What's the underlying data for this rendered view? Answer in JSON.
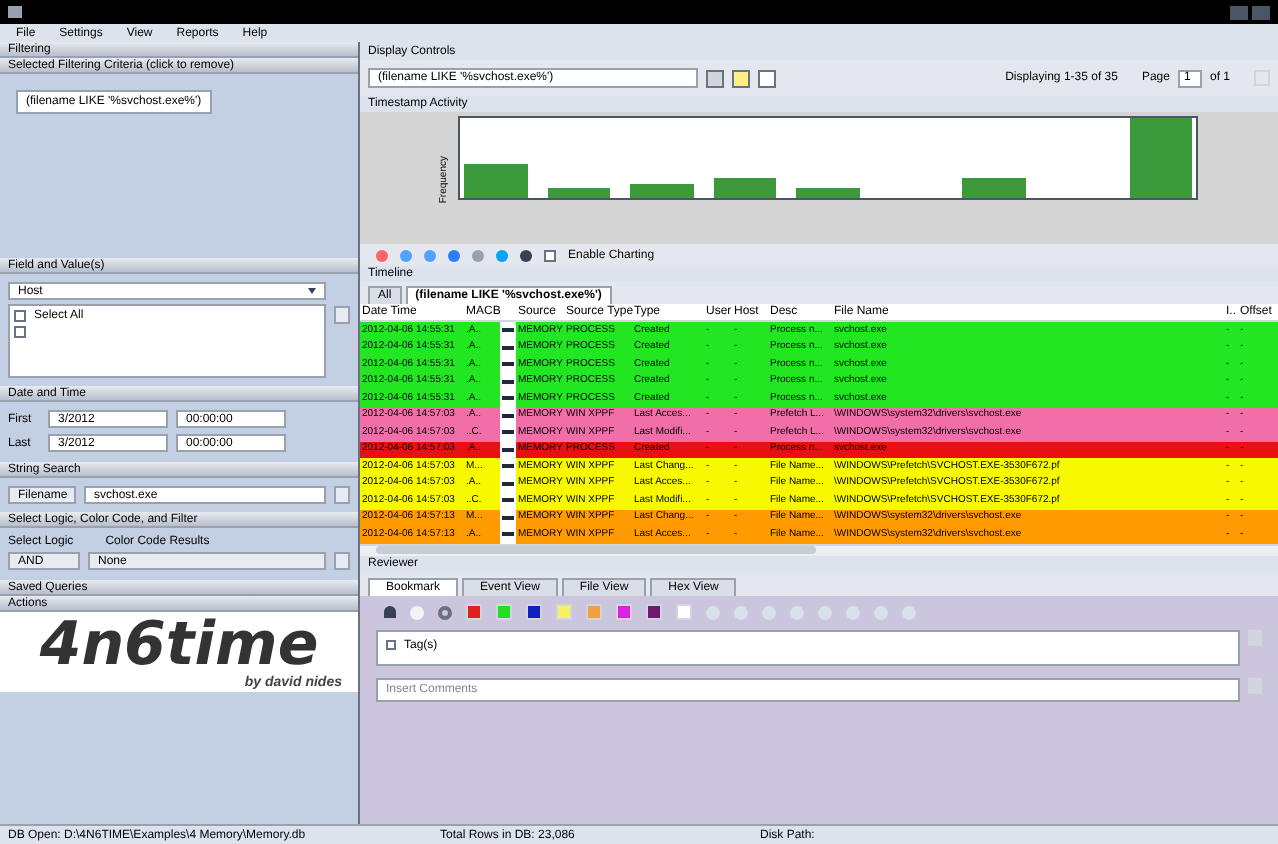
{
  "menu": [
    "File",
    "Settings",
    "View",
    "Reports",
    "Help"
  ],
  "filtering": {
    "title": "Filtering",
    "criteria_header": "Selected Filtering Criteria (click to remove)",
    "criteria": [
      "(filename LIKE '%svchost.exe%')"
    ],
    "field_header": "Field and Value(s)",
    "field": "Host",
    "values": [
      {
        "label": "Select All",
        "checked": false
      },
      {
        "checked": false
      }
    ],
    "date_header": "Date and Time",
    "dates": [
      {
        "label": "First",
        "date": "3/2012",
        "time": "00:00:00"
      },
      {
        "label": "Last",
        "date": "3/2012",
        "time": "00:00:00"
      }
    ],
    "string_header": "String Search",
    "string_field": "Filename",
    "string_value": "svchost.exe",
    "logic_header": "Select Logic, Color Code, and Filter",
    "logic_label": "Select Logic",
    "color_label": "Color Code Results",
    "logic": "AND",
    "color_code": "None",
    "saved_header": "Saved Queries",
    "actions_header": "Actions"
  },
  "logo": {
    "name": "4n6time",
    "byline": "by david nides"
  },
  "display": {
    "title": "Display Controls",
    "filter": "(filename LIKE '%svchost.exe%')",
    "displaying": "Displaying 1-35 of 35",
    "page_label": "Page",
    "page": "1",
    "of": "of 1"
  },
  "activity": {
    "title": "Timestamp Activity",
    "ylabel": "Frequency"
  },
  "chart_toolbar": {
    "enable_charting": "Enable Charting",
    "checked": false
  },
  "timeline": {
    "title": "Timeline",
    "tabs": [
      {
        "label": "All",
        "selected": false
      },
      {
        "label": "(filename LIKE '%svchost.exe%')",
        "selected": true
      }
    ],
    "columns": [
      "Date Time",
      "MACB",
      "Source",
      "Source Type",
      "Type",
      "User",
      "Host",
      "Desc",
      "File Name",
      "I..",
      "Offset"
    ],
    "rows": [
      {
        "color": "#22e622",
        "cells": [
          "2012-04-06 14:55:31",
          ".A..",
          "MEMORY",
          "PROCESS",
          "Created",
          "-",
          "-",
          "Process n...",
          "svchost.exe",
          "-",
          "-"
        ]
      },
      {
        "color": "#22e622",
        "cells": [
          "2012-04-06 14:55:31",
          ".A..",
          "MEMORY",
          "PROCESS",
          "Created",
          "-",
          "-",
          "Process n...",
          "svchost.exe",
          "-",
          "-"
        ]
      },
      {
        "color": "#22e622",
        "cells": [
          "2012-04-06 14:55:31",
          ".A..",
          "MEMORY",
          "PROCESS",
          "Created",
          "-",
          "-",
          "Process n...",
          "svchost.exe",
          "-",
          "-"
        ]
      },
      {
        "color": "#22e622",
        "cells": [
          "2012-04-06 14:55:31",
          ".A..",
          "MEMORY",
          "PROCESS",
          "Created",
          "-",
          "-",
          "Process n...",
          "svchost.exe",
          "-",
          "-"
        ]
      },
      {
        "color": "#22e622",
        "cells": [
          "2012-04-06 14:55:31",
          ".A..",
          "MEMORY",
          "PROCESS",
          "Created",
          "-",
          "-",
          "Process n...",
          "svchost.exe",
          "-",
          "-"
        ]
      },
      {
        "color": "#f26ea8",
        "cells": [
          "2012-04-06 14:57:03",
          ".A..",
          "MEMORY",
          "WIN XPPF",
          "Last Acces...",
          "-",
          "-",
          "Prefetch L...",
          "\\WINDOWS\\system32\\drivers\\svchost.exe",
          "-",
          "-"
        ]
      },
      {
        "color": "#f26ea8",
        "cells": [
          "2012-04-06 14:57:03",
          "..C.",
          "MEMORY",
          "WIN XPPF",
          "Last Modifi...",
          "-",
          "-",
          "Prefetch L...",
          "\\WINDOWS\\system32\\drivers\\svchost.exe",
          "-",
          "-"
        ]
      },
      {
        "color": "#e81010",
        "cells": [
          "2012-04-06 14:57:03",
          ".A..",
          "MEMORY",
          "PROCESS",
          "Created",
          "-",
          "-",
          "Process n...",
          "svchost.exe",
          "-",
          "-"
        ]
      },
      {
        "color": "#f8f800",
        "cells": [
          "2012-04-06 14:57:03",
          "M...",
          "MEMORY",
          "WIN XPPF",
          "Last Chang...",
          "-",
          "-",
          "File Name...",
          "\\WINDOWS\\Prefetch\\SVCHOST.EXE-3530F672.pf",
          "-",
          "-"
        ]
      },
      {
        "color": "#f8f800",
        "cells": [
          "2012-04-06 14:57:03",
          ".A..",
          "MEMORY",
          "WIN XPPF",
          "Last Acces...",
          "-",
          "-",
          "File Name...",
          "\\WINDOWS\\Prefetch\\SVCHOST.EXE-3530F672.pf",
          "-",
          "-"
        ]
      },
      {
        "color": "#f8f800",
        "cells": [
          "2012-04-06 14:57:03",
          "..C.",
          "MEMORY",
          "WIN XPPF",
          "Last Modifi...",
          "-",
          "-",
          "File Name...",
          "\\WINDOWS\\Prefetch\\SVCHOST.EXE-3530F672.pf",
          "-",
          "-"
        ]
      },
      {
        "color": "#ff9a00",
        "cells": [
          "2012-04-06 14:57:13",
          "M...",
          "MEMORY",
          "WIN XPPF",
          "Last Chang...",
          "-",
          "-",
          "File Name...",
          "\\WINDOWS\\system32\\drivers\\svchost.exe",
          "-",
          "-"
        ]
      },
      {
        "color": "#ff9a00",
        "cells": [
          "2012-04-06 14:57:13",
          ".A..",
          "MEMORY",
          "WIN XPPF",
          "Last Acces...",
          "-",
          "-",
          "File Name...",
          "\\WINDOWS\\system32\\drivers\\svchost.exe",
          "-",
          "-"
        ]
      }
    ]
  },
  "reviewer": {
    "title": "Reviewer",
    "tabs": [
      {
        "label": "Bookmark",
        "selected": true
      },
      {
        "label": "Event View",
        "selected": false
      },
      {
        "label": "File View",
        "selected": false
      },
      {
        "label": "Hex View",
        "selected": false
      }
    ],
    "swatches": [
      {
        "color": "#e02020"
      },
      {
        "color": "#22dd22"
      },
      {
        "color": "#1020c0"
      },
      {
        "color": "#f8f060"
      },
      {
        "color": "#f0a040"
      },
      {
        "color": "#e020e0"
      },
      {
        "color": "#701870"
      },
      {
        "color": "#ffffff"
      }
    ],
    "tags": "Tag(s)",
    "tags_checked": false,
    "placeholder": "Insert Comments"
  },
  "status_bar": {
    "db": "DB Open: D:\\4N6TIME\\Examples\\4 Memory\\Memory.db",
    "rows": "Total Rows in DB: 23,086",
    "disk": "Disk Path:"
  }
}
